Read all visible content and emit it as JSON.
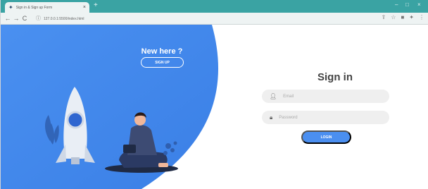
{
  "browser": {
    "tab_title": "Sign in & Sign up Form",
    "tab_close": "×",
    "new_tab": "+",
    "back": "←",
    "forward": "→",
    "reload": "C",
    "url": "127.0.0.1:5500/index.html",
    "minimize": "–",
    "maximize": "□",
    "close": "×"
  },
  "panel": {
    "heading": "New here ?",
    "signup_label": "SIGN UP"
  },
  "form": {
    "title": "Sign in",
    "email_placeholder": "Email",
    "password_placeholder": "Password",
    "login_label": "LOGIN"
  },
  "colors": {
    "primary": "#4b8ff0",
    "tabbar": "#3aa3a3"
  }
}
